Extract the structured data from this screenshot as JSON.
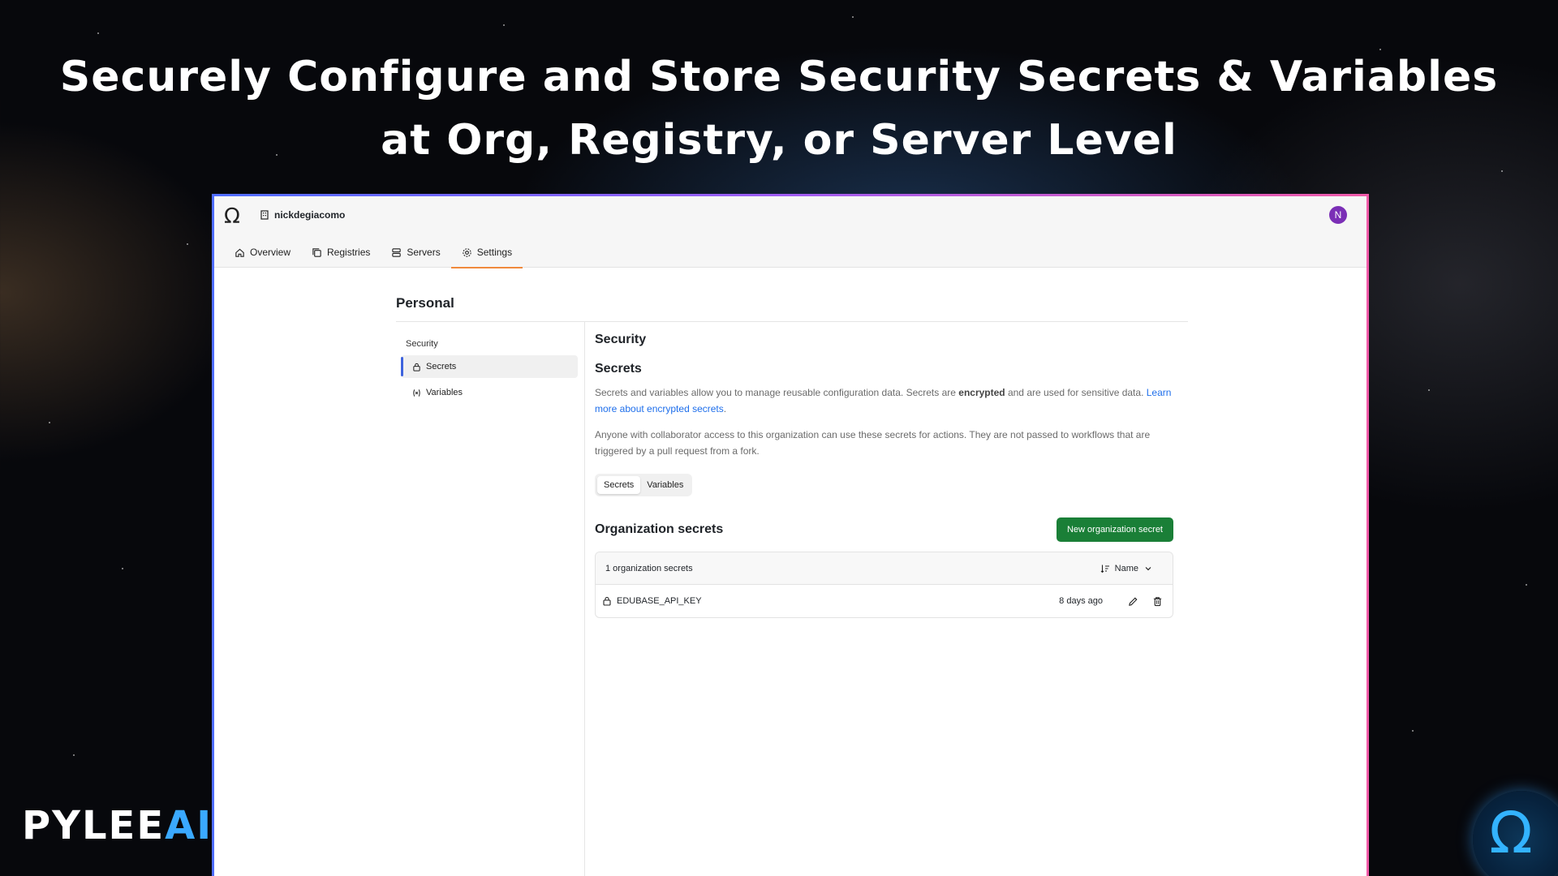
{
  "headline": {
    "line1": "Securely Configure and Store Security Secrets & Variables",
    "line2": "at Org, Registry, or Server Level"
  },
  "app": {
    "logo_icon": "omega-icon",
    "org_icon": "building-icon",
    "org_name": "nickdegiacomo",
    "avatar_initial": "N",
    "avatar_color": "#7b2fb6",
    "tabs": [
      {
        "label": "Overview",
        "icon": "home-icon"
      },
      {
        "label": "Registries",
        "icon": "copy-icon"
      },
      {
        "label": "Servers",
        "icon": "server-icon"
      },
      {
        "label": "Settings",
        "icon": "gear-icon",
        "active": true
      }
    ],
    "tab_accent": "#f08a3c"
  },
  "settings": {
    "section_title": "Personal",
    "sidebar": {
      "heading": "Security",
      "items": [
        {
          "label": "Secrets",
          "icon": "lock-icon",
          "active": true
        },
        {
          "label": "Variables",
          "icon": "variable-icon"
        }
      ]
    },
    "main": {
      "title": "Security",
      "subtitle": "Secrets",
      "para1_a": "Secrets and variables allow you to manage reusable configuration data. Secrets are ",
      "para1_bold": "encrypted",
      "para1_b": " and are used for sensitive data. ",
      "para1_link": "Learn more about encrypted secrets",
      "para1_end": ".",
      "para2": "Anyone with collaborator access to this organization can use these secrets for actions. They are not passed to workflows that are triggered by a pull request from a fork.",
      "segmented": {
        "secrets": "Secrets",
        "variables": "Variables",
        "selected": "Secrets"
      },
      "org_secrets_title": "Organization secrets",
      "new_button": "New organization secret",
      "new_button_color": "#1a7f37",
      "table": {
        "count_label": "1 organization secrets",
        "sort_label": "Name",
        "rows": [
          {
            "name": "EDUBASE_API_KEY",
            "updated": "8 days ago"
          }
        ]
      }
    }
  },
  "brand": {
    "part1": "PYLEE",
    "part2": "AI"
  },
  "corner_logo_icon": "omega-icon"
}
